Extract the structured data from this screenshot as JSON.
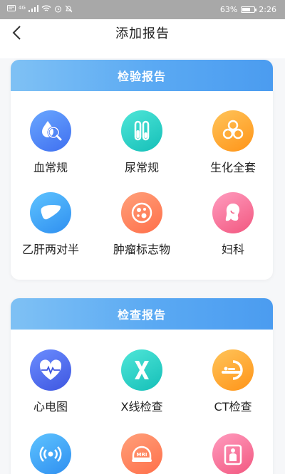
{
  "status_bar": {
    "network": "4G",
    "battery_percent": "63%",
    "battery_level": 0.63,
    "time": "2:26"
  },
  "nav": {
    "title": "添加报告"
  },
  "lab_section": {
    "title": "检验报告",
    "items": [
      {
        "label": "血常规",
        "icon": "blood-test-icon"
      },
      {
        "label": "尿常规",
        "icon": "test-tubes-icon"
      },
      {
        "label": "生化全套",
        "icon": "biohazard-icon"
      },
      {
        "label": "乙肝两对半",
        "icon": "liver-icon"
      },
      {
        "label": "肿瘤标志物",
        "icon": "cell-icon"
      },
      {
        "label": "妇科",
        "icon": "woman-icon"
      }
    ]
  },
  "exam_section": {
    "title": "检查报告",
    "items": [
      {
        "label": "心电图",
        "icon": "heart-ecg-icon"
      },
      {
        "label": "X线检查",
        "icon": "x-ray-icon"
      },
      {
        "label": "CT检查",
        "icon": "ct-scanner-icon"
      },
      {
        "label": "",
        "icon": "ultrasound-icon"
      },
      {
        "label": "",
        "icon": "mri-icon"
      },
      {
        "label": "",
        "icon": "body-scan-icon"
      }
    ]
  },
  "colors": {
    "header_gradient_start": "#7fc1f4",
    "header_gradient_end": "#4b9cf0",
    "page_background": "#f6f7f9"
  }
}
